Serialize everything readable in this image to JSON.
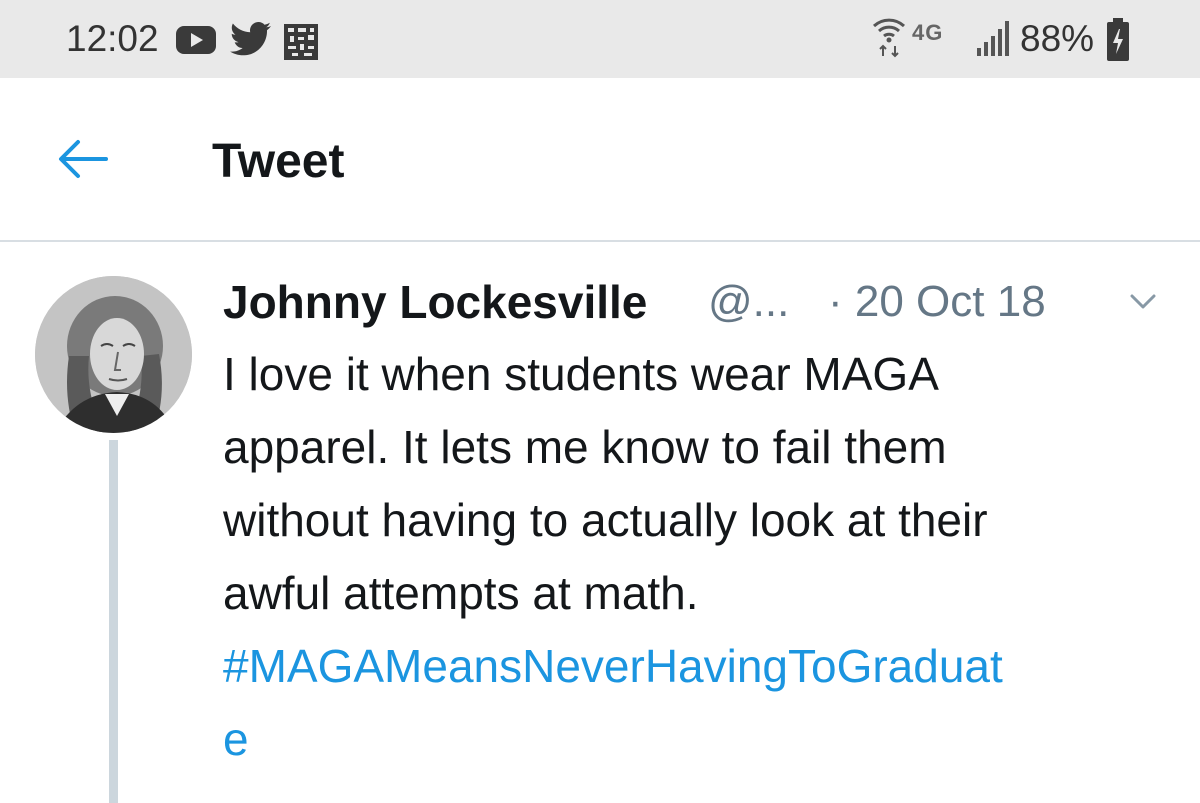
{
  "status_bar": {
    "time": "12:02",
    "notification_icons": [
      "youtube-icon",
      "twitter-bird-icon",
      "notification-icon"
    ],
    "network_label": "4G",
    "battery": "88%"
  },
  "header": {
    "back_icon": "arrow-left-icon",
    "title": "Tweet"
  },
  "tweet": {
    "author_name": "Johnny Lockesville",
    "handle": "@...",
    "date": "· 20 Oct 18",
    "text_lines": [
      "I love it when students wear MAGA",
      "apparel. It lets me know to fail them",
      "without having to actually look at their",
      "awful attempts at math."
    ],
    "hashtag_lines": [
      "#MAGAMeansNeverHavingToGraduat",
      "e"
    ]
  },
  "colors": {
    "accent": "#1b95e0",
    "text": "#14171a",
    "secondary_text": "#657786",
    "status_bar_bg": "#e9e9e9",
    "divider": "#d8dee3"
  }
}
